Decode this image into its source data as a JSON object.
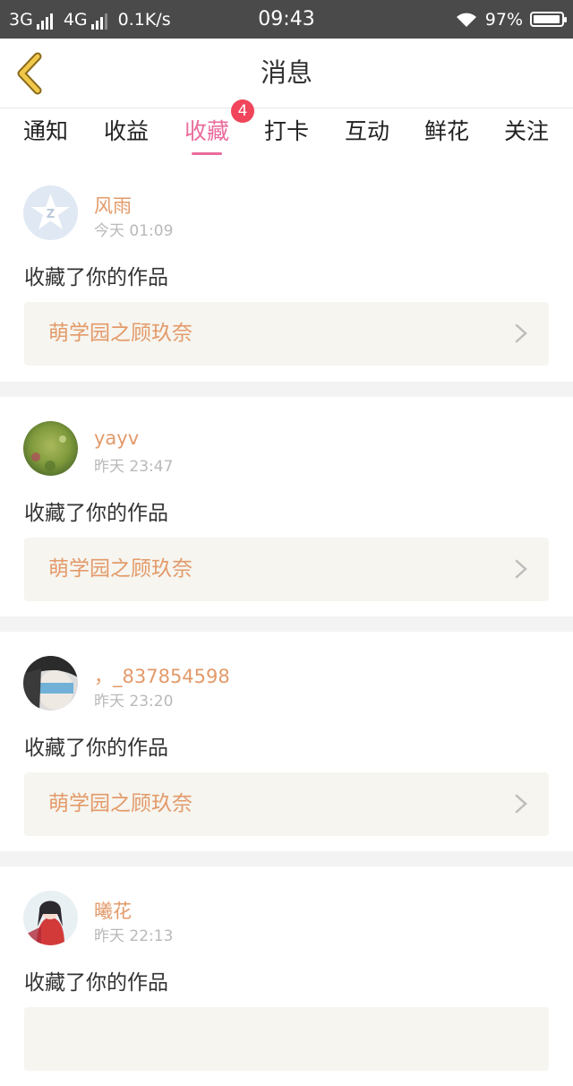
{
  "status_bar": {
    "net1": "3G",
    "net2": "4G",
    "speed": "0.1K/s",
    "time": "09:43",
    "battery": "97%",
    "battery_level": 0.97
  },
  "header": {
    "title": "消息"
  },
  "tabs": [
    {
      "label": "通知"
    },
    {
      "label": "收益"
    },
    {
      "label": "收藏",
      "badge": "4",
      "active": true
    },
    {
      "label": "打卡"
    },
    {
      "label": "互动"
    },
    {
      "label": "鲜花"
    },
    {
      "label": "关注"
    }
  ],
  "items": [
    {
      "name": "风雨",
      "time": "今天 01:09",
      "action": "收藏了你的作品",
      "work": "萌学园之顾玖奈",
      "avatar": "qq-default-avatar"
    },
    {
      "name": "yayv",
      "time": "昨天 23:47",
      "action": "收藏了你的作品",
      "work": "萌学园之顾玖奈",
      "avatar": "green-field-avatar"
    },
    {
      "name": "，_837854598",
      "time": "昨天 23:20",
      "action": "收藏了你的作品",
      "work": "萌学园之顾玖奈",
      "avatar": "face-photo-avatar"
    },
    {
      "name": "曦花",
      "time": "昨天 22:13",
      "action": "收藏了你的作品",
      "work": "",
      "avatar": "anime-girl-avatar"
    }
  ],
  "colors": {
    "accent": "#e96c9c",
    "badge": "#f0455a",
    "username": "#e39a6a",
    "card_bg": "#f6f5ef",
    "status_bar": "#4a4a4a"
  }
}
